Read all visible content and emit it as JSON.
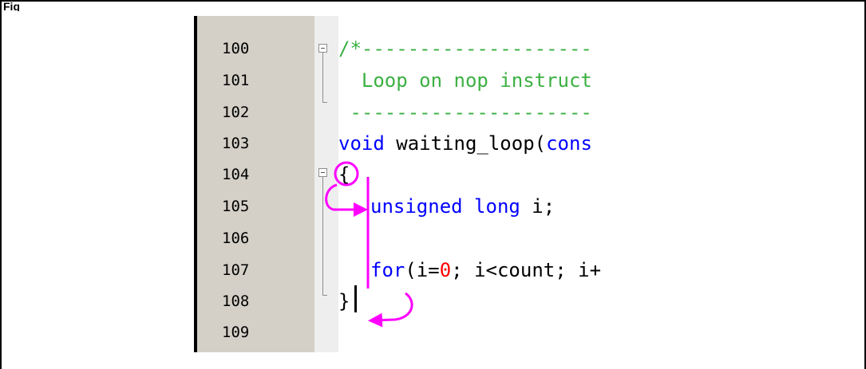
{
  "figure": {
    "label": "Fig"
  },
  "line_numbers": [
    "100",
    "101",
    "102",
    "103",
    "104",
    "105",
    "106",
    "107",
    "108",
    "109"
  ],
  "code": {
    "comment_open": "/*--------------------",
    "comment_text": "  Loop on nop instruct",
    "comment_close": " ---------------------",
    "func_keyword": "void",
    "func_name": " waiting_loop(",
    "func_param_kw": "cons",
    "brace_open": "{",
    "decl_keyword": "unsigned long",
    "decl_rest": " i;",
    "for_keyword": "for",
    "for_part1": "(i=",
    "for_zero": "0",
    "for_part2": "; i<count; i+",
    "brace_close": "}"
  },
  "colors": {
    "comment": "#3cb043",
    "keyword": "#0000ff",
    "number": "#ff0000",
    "annotation": "#ff00ff",
    "gutter": "#d4d0c8"
  }
}
